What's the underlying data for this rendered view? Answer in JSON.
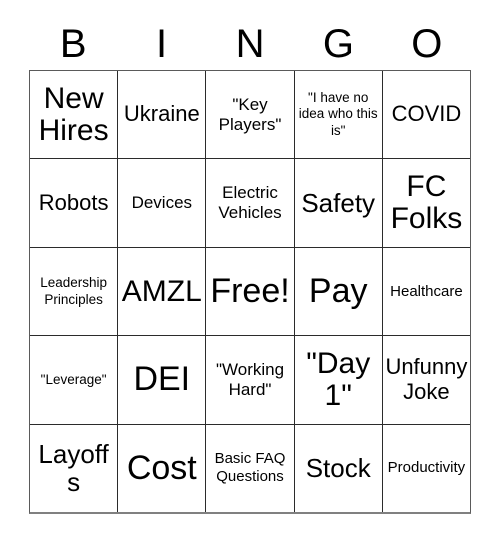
{
  "card": {
    "title": "BINGO",
    "header_letters": [
      "B",
      "I",
      "N",
      "G",
      "O"
    ],
    "background_color": "#ffffff",
    "text_color": "#000000",
    "grid_line_color": "#2b2b2b",
    "outer_border_color": "#5a5a5a",
    "rows": 5,
    "columns": 5,
    "free_space": "Free!"
  },
  "cells": [
    [
      {
        "text": "New Hires",
        "size": "fs-2xl"
      },
      {
        "text": "Ukraine",
        "size": "fs-lg"
      },
      {
        "text": "\"Key Players\"",
        "size": "fs-md"
      },
      {
        "text": "\"I have no idea who this is\"",
        "size": "fs-xs"
      },
      {
        "text": "COVID",
        "size": "fs-lg"
      }
    ],
    [
      {
        "text": "Robots",
        "size": "fs-lg"
      },
      {
        "text": "Devices",
        "size": "fs-md"
      },
      {
        "text": "Electric Vehicles",
        "size": "fs-md"
      },
      {
        "text": "Safety",
        "size": "fs-xl"
      },
      {
        "text": "FC Folks",
        "size": "fs-2xl"
      }
    ],
    [
      {
        "text": "Leadership Principles",
        "size": "fs-xs"
      },
      {
        "text": "AMZL",
        "size": "fs-2xl"
      },
      {
        "text": "Free!",
        "size": "fs-3xl"
      },
      {
        "text": "Pay",
        "size": "fs-3xl"
      },
      {
        "text": "Healthcare",
        "size": "fs-sm"
      }
    ],
    [
      {
        "text": "\"Leverage\"",
        "size": "fs-xs"
      },
      {
        "text": "DEI",
        "size": "fs-3xl"
      },
      {
        "text": "\"Working Hard\"",
        "size": "fs-md"
      },
      {
        "text": "\"Day 1\"",
        "size": "fs-2xl"
      },
      {
        "text": "Unfunny Joke",
        "size": "fs-lg"
      }
    ],
    [
      {
        "text": "Layoffs",
        "size": "fs-xl"
      },
      {
        "text": "Cost",
        "size": "fs-3xl"
      },
      {
        "text": "Basic FAQ Questions",
        "size": "fs-sm"
      },
      {
        "text": "Stock",
        "size": "fs-xl"
      },
      {
        "text": "Productivity",
        "size": "fs-sm"
      }
    ]
  ]
}
